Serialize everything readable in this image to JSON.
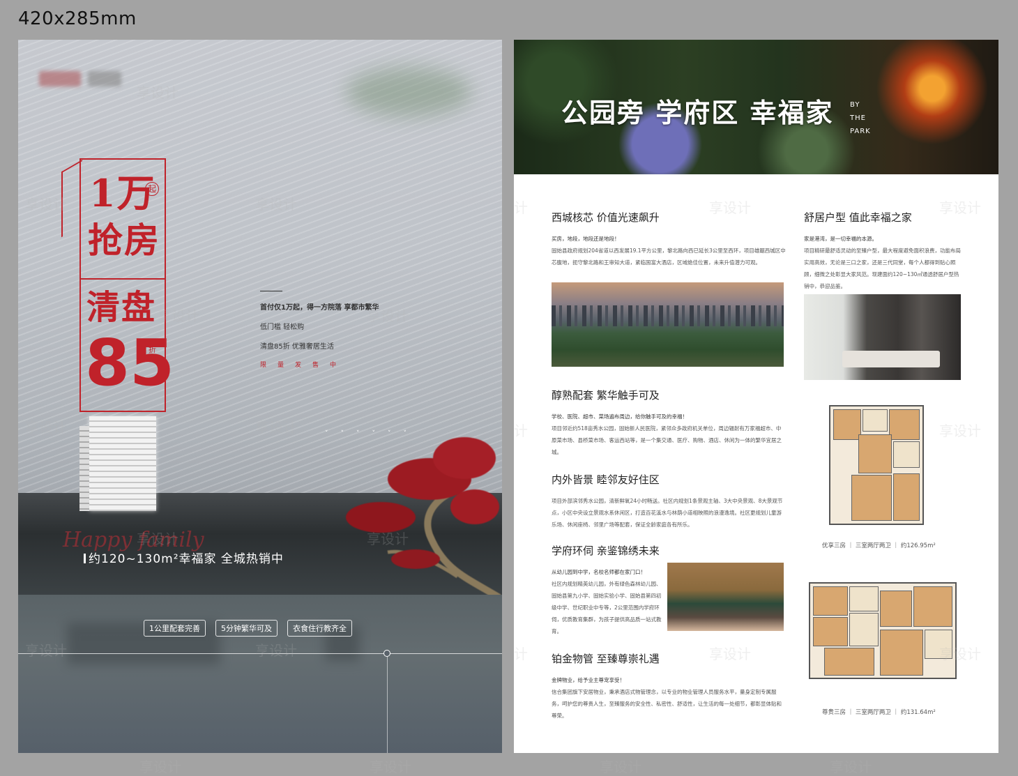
{
  "size_label": "420x285mm",
  "left_poster": {
    "promo": {
      "line1": "1万",
      "badge": "起",
      "line2": "抢房",
      "line3": "清盘",
      "line4": "85",
      "discount_unit": "折"
    },
    "taglines": [
      "首付仅1万起，得一方院落  享都市繁华",
      "低门槛  轻松购",
      "清盘85折  优雅奢居生活",
      "限量发售中"
    ],
    "script_text": "Happy family",
    "headline": "约120~130m²幸福家   全城热销中",
    "chips": [
      "1公里配套完善",
      "5分钟繁华可及",
      "衣食住行教齐全"
    ]
  },
  "right_poster": {
    "banner": {
      "title": "公园旁 学府区 幸福家",
      "by_lines": [
        "BY",
        "THE",
        "PARK"
      ]
    },
    "sections": [
      {
        "title": "西城核芯 价值光速飙升",
        "lead": "买房，地段，地段还是地段！",
        "body": "固始县政府规划204省道以西发展19.1平方公里，黎北路向西已延长3公里至西环，项目雄踞西城区中芯腹地，扼守黎北路和王审知大道，紧临国富大酒店，区域绝佳位置，未来升值潜力可观。"
      },
      {
        "title": "舒居户型 值此幸福之家",
        "lead": "家是港湾，是一切幸福的本源。",
        "body": "项目精研最舒适灵动的至臻户型，最大程度避免面积浪费，功能布局实用高效，无论是三口之家，还是三代同堂，每个人都得到贴心照顾，细微之处彰显大家风范。现建面约120~130㎡通透舒居户型热销中，恭迎品鉴。"
      },
      {
        "title": "醇熟配套 繁华触手可及",
        "lead": "学校、医院、超市、菜场遍布周边，给你触手可及的幸福！",
        "body": "项目邻近约518亩秀水公园，固始新人民医院，紧邻众多政府机关单位，周边辐射有万家福超市、中原菜市场、县桥菜市场、客运西站等，是一个集交通、医疗、购物、酒店、休闲为一体的繁华宜居之城。"
      },
      {
        "title": "内外皆景 睦邻友好住区",
        "lead": "",
        "body": "项目外部滨邻秀水公园，清新鲜氧24小时畅送。社区内规划1条景观主轴、3大中央景观、8大景观节点，小区中央设立景观水系休闲区，打造百花溪水与林荫小道相映照的浪漫逸境。社区更规划儿童游乐场、休闲座椅、邻里广场等配套，保证全龄家庭各有所乐。"
      },
      {
        "title": "学府环伺 亲鉴锦绣未来",
        "lead": "从幼儿园到中学，名校名师都在家门口！",
        "body": "社区内规划精英幼儿园，外有绿色森林幼儿园、固始县第九小学、固始实验小学、固始县第四初级中学、世纪职业中专等，2公里范围内学府环伺，优质教育集群，为孩子提供高品质一站式教育。"
      },
      {
        "title": "铂金物管 至臻尊崇礼遇",
        "lead": "金牌物业，给予业主尊宠享受！",
        "body": "信合集团旗下安居物业，秉承酒店式物管理念，以专业的物业管理人员服务水平，量身定制专属服务，呵护您的尊贵人生，至臻服务的安全性、私密性、舒适性，让生活的每一处细节，都彰显体贴和尊荣。"
      }
    ],
    "floorplans": [
      {
        "name": "优享三房",
        "layout": "三室两厅两卫",
        "area": "约126.95m²"
      },
      {
        "name": "尊贵三房",
        "layout": "三室两厅两卫",
        "area": "约131.64m²"
      }
    ]
  },
  "colors": {
    "accent_red": "#c0222a",
    "bg": "#a3a3a3"
  }
}
